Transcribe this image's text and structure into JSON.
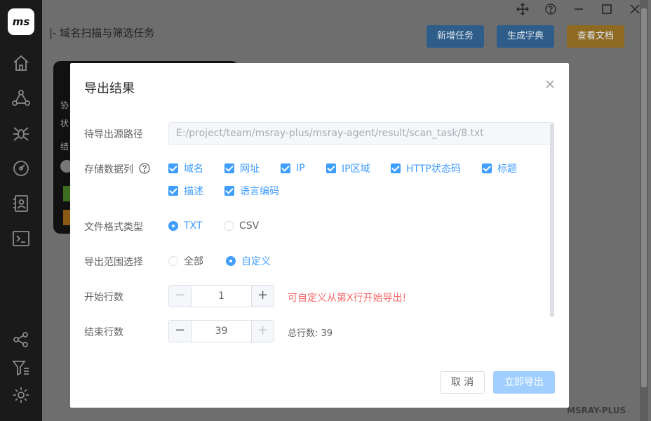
{
  "app": {
    "logo_text": "ms",
    "page_title": "|- 域名扫描与筛选任务",
    "watermark": "MSRAY-PLUS"
  },
  "sidebar": {
    "items": [
      {
        "icon": "home-icon"
      },
      {
        "icon": "nodes-icon"
      },
      {
        "icon": "spider-icon"
      },
      {
        "icon": "gauge-icon"
      },
      {
        "icon": "contact-icon"
      },
      {
        "icon": "terminal-icon"
      },
      {
        "icon": "share-icon"
      },
      {
        "icon": "filter-icon"
      },
      {
        "icon": "gear-icon"
      }
    ]
  },
  "toolbar": {
    "new_task": "新增任务",
    "gen_dict": "生成字典",
    "view_docs": "查看文档"
  },
  "background_card": {
    "labels": [
      "协",
      "状",
      "结"
    ]
  },
  "dialog": {
    "title": "导出结果",
    "source_path_label": "待导出源路径",
    "source_path_value": "E:/project/team/msray-plus/msray-agent/result/scan_task/8.txt",
    "columns_label": "存储数据列",
    "columns": [
      {
        "label": "域名",
        "checked": true
      },
      {
        "label": "网址",
        "checked": true
      },
      {
        "label": "IP",
        "checked": true
      },
      {
        "label": "IP区域",
        "checked": true
      },
      {
        "label": "HTTP状态码",
        "checked": true
      },
      {
        "label": "标题",
        "checked": true
      },
      {
        "label": "描述",
        "checked": true
      },
      {
        "label": "语言编码",
        "checked": true
      }
    ],
    "format_label": "文件格式类型",
    "formats": [
      {
        "label": "TXT",
        "selected": true
      },
      {
        "label": "CSV",
        "selected": false
      }
    ],
    "range_label": "导出范围选择",
    "ranges": [
      {
        "label": "全部",
        "selected": false
      },
      {
        "label": "自定义",
        "selected": true
      }
    ],
    "start_label": "开始行数",
    "start_value": "1",
    "start_hint": "可自定义从第X行开始导出!",
    "end_label": "结束行数",
    "end_value": "39",
    "total_text": "总行数: 39",
    "cancel_label": "取 消",
    "export_label": "立即导出"
  },
  "colors": {
    "primary": "#409eff",
    "danger": "#f56c6c",
    "sidebar_bg": "#1a1a1a"
  }
}
